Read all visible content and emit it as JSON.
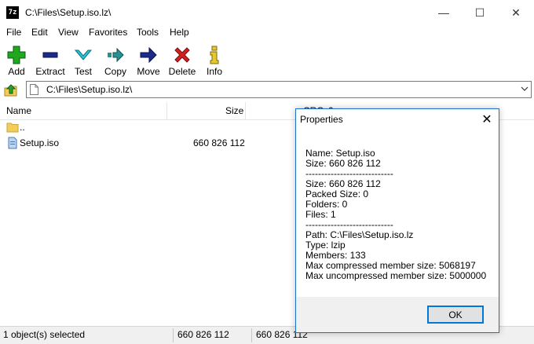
{
  "window": {
    "title": "C:\\Files\\Setup.iso.lz\\",
    "icon_text": "7z",
    "minimize": "—",
    "maximize": "☐",
    "close": "✕"
  },
  "menu": [
    "File",
    "Edit",
    "View",
    "Favorites",
    "Tools",
    "Help"
  ],
  "toolbar": {
    "add": "Add",
    "extract": "Extract",
    "test": "Test",
    "copy": "Copy",
    "move": "Move",
    "delete": "Delete",
    "info": "Info"
  },
  "address": {
    "path": "C:\\Files\\Setup.iso.lz\\"
  },
  "list": {
    "columns": {
      "name": "Name",
      "size": "Size",
      "crc": "CRC",
      "extra": "0"
    },
    "rows": [
      {
        "name": "..",
        "size": "",
        "icon": "folder-icon"
      },
      {
        "name": "Setup.iso",
        "size": "660 826 112",
        "icon": "file-icon"
      }
    ]
  },
  "status": {
    "selected": "1 object(s) selected",
    "size": "660 826 112",
    "packed": "660 826 112"
  },
  "dialog": {
    "title": "Properties",
    "close": "✕",
    "lines": [
      "Name: Setup.iso",
      "Size: 660 826 112",
      "----------------------------",
      "Size: 660 826 112",
      "Packed Size: 0",
      "Folders: 0",
      "Files: 1",
      "----------------------------",
      "Path: C:\\Files\\Setup.iso.lz",
      "Type: lzip",
      "Members: 133",
      "Max compressed member size: 5068197",
      "Max uncompressed member size: 5000000"
    ],
    "ok": "OK"
  },
  "colors": {
    "accent": "#0078d7",
    "add_green": "#1fa81f",
    "extract_blue": "#1c2a8c",
    "test_cyan": "#27c5d6",
    "copy_teal": "#2a8f8f",
    "delete_red": "#d21f1f",
    "info_yellow": "#e8c82a",
    "folder_yellow": "#f3cc59"
  }
}
